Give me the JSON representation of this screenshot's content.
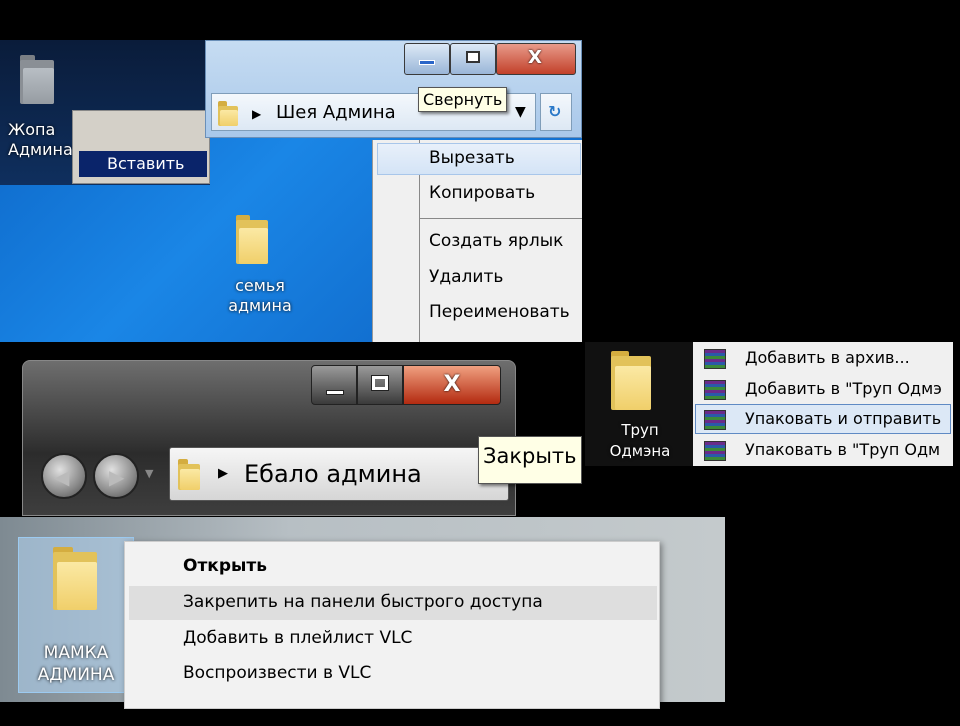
{
  "panel1": {
    "desktop_icon_label": "Жопа\nАдмина",
    "paste_menu_item": "Вставить",
    "window": {
      "address_text": "Шея Админа",
      "close_glyph": "X",
      "tooltip": "Свернуть"
    },
    "context_menu": {
      "items": [
        "Вырезать",
        "Копировать",
        "Создать ярлык",
        "Удалить",
        "Переименовать"
      ],
      "highlighted": "Вырезать"
    },
    "folder_label": "семья\nадмина"
  },
  "panel2": {
    "address_text": "Ебало админа",
    "close_glyph": "X",
    "tooltip": "Закрыть"
  },
  "panel3": {
    "folder_label": "Труп\nОдмэна",
    "menu_items": [
      "Добавить в архив...",
      "Добавить в \"Труп Одмэ",
      "Упаковать и отправить",
      "Упаковать в \"Труп Одм"
    ],
    "highlighted": "Упаковать и отправить"
  },
  "panel4": {
    "folder_label": "МАМКА\nАДМИНА",
    "menu_items": [
      "Открыть",
      "Закрепить на панели быстрого доступа",
      "Добавить в плейлист VLC",
      "Воспроизвести в VLC"
    ],
    "bold_item": "Открыть",
    "highlighted": "Закрепить на панели быстрого доступа"
  }
}
